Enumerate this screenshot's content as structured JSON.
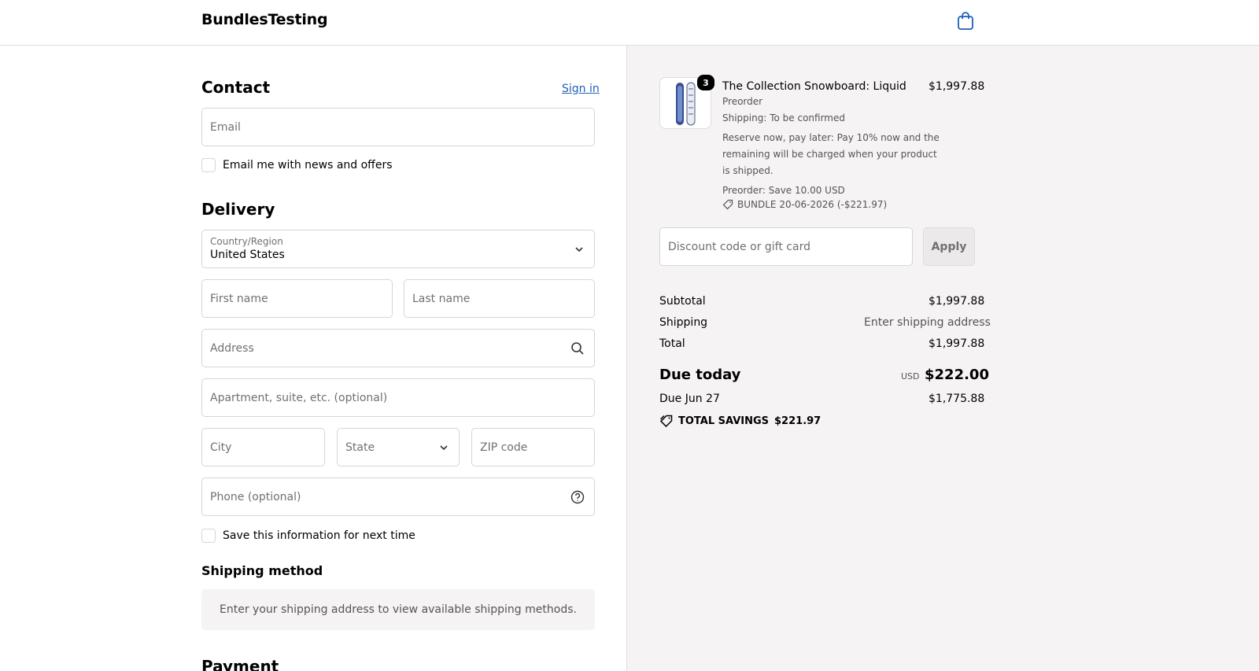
{
  "header": {
    "brand": "BundlesTesting",
    "cart_icon": "shopping-bag-icon"
  },
  "contact": {
    "title": "Contact",
    "sign_in": "Sign in",
    "email_placeholder": "Email",
    "news_label": "Email me with news and offers"
  },
  "delivery": {
    "title": "Delivery",
    "country_label": "Country/Region",
    "country_value": "United States",
    "first_name_placeholder": "First name",
    "last_name_placeholder": "Last name",
    "address_placeholder": "Address",
    "apartment_placeholder": "Apartment, suite, etc. (optional)",
    "city_placeholder": "City",
    "state_placeholder": "State",
    "zip_placeholder": "ZIP code",
    "phone_placeholder": "Phone (optional)",
    "save_info_label": "Save this information for next time"
  },
  "shipping_method": {
    "title": "Shipping method",
    "notice": "Enter your shipping address to view available shipping methods."
  },
  "payment": {
    "title": "Payment"
  },
  "order": {
    "item": {
      "quantity": "3",
      "name": "The Collection Snowboard: Liquid",
      "price": "$1,997.88",
      "variant": "Preorder",
      "shipping": "Shipping: To be confirmed",
      "reserve_line1": "Reserve now, pay later: Pay 10% now and the",
      "reserve_line2": "remaining will be charged when your product",
      "reserve_line3": "is shipped.",
      "preorder_save": "Preorder: Save 10.00 USD",
      "bundle": "BUNDLE 20-06-2026 (-$221.97)"
    },
    "discount_placeholder": "Discount code or gift card",
    "apply_label": "Apply",
    "subtotal_label": "Subtotal",
    "subtotal_value": "$1,997.88",
    "shipping_label": "Shipping",
    "shipping_value": "Enter shipping address",
    "total_label": "Total",
    "total_value": "$1,997.88",
    "due_today_label": "Due today",
    "due_today_currency": "USD",
    "due_today_value": "$222.00",
    "due_later_label": "Due Jun 27",
    "due_later_value": "$1,775.88",
    "savings_label": "TOTAL SAVINGS",
    "savings_value": "$221.97"
  }
}
